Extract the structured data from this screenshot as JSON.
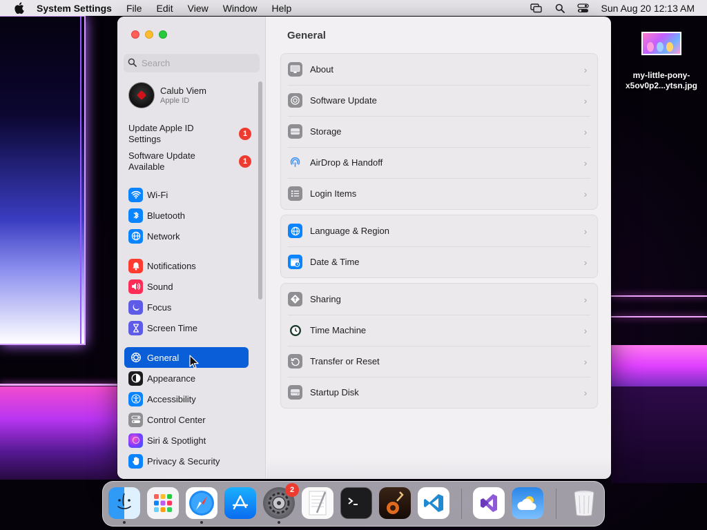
{
  "menubar": {
    "app_name": "System Settings",
    "menus": [
      "File",
      "Edit",
      "View",
      "Window",
      "Help"
    ],
    "status_icons": [
      "screen-mirroring-icon",
      "spotlight-search-icon",
      "control-center-icon"
    ],
    "clock": "Sun Aug 20  12:13 AM"
  },
  "desktop": {
    "file_name_line1": "my-little-pony-",
    "file_name_line2": "x5ov0p2...ytsn.jpg"
  },
  "sidebar": {
    "search_placeholder": "Search",
    "account": {
      "name": "Calub Viem",
      "subtitle": "Apple ID"
    },
    "notices": [
      {
        "label": "Update Apple ID Settings",
        "badge": "1"
      },
      {
        "label": "Software Update Available",
        "badge": "1"
      }
    ],
    "items": [
      {
        "label": "Wi-Fi",
        "icon": "wifi-icon",
        "color": "#0a84ff"
      },
      {
        "label": "Bluetooth",
        "icon": "bluetooth-icon",
        "color": "#0a84ff"
      },
      {
        "label": "Network",
        "icon": "globe-icon",
        "color": "#0a84ff"
      },
      {
        "label": "Notifications",
        "icon": "bell-icon",
        "color": "#ff3b30"
      },
      {
        "label": "Sound",
        "icon": "speaker-icon",
        "color": "#ff2d55"
      },
      {
        "label": "Focus",
        "icon": "moon-icon",
        "color": "#5e5ce6"
      },
      {
        "label": "Screen Time",
        "icon": "hourglass-icon",
        "color": "#5e5ce6"
      },
      {
        "label": "General",
        "icon": "gear-icon",
        "color": "#8e8e93",
        "active": true
      },
      {
        "label": "Appearance",
        "icon": "appearance-icon",
        "color": "#1c1c1e"
      },
      {
        "label": "Accessibility",
        "icon": "accessibility-icon",
        "color": "#0a84ff"
      },
      {
        "label": "Control Center",
        "icon": "control-center-icon",
        "color": "#8e8e93"
      },
      {
        "label": "Siri & Spotlight",
        "icon": "siri-icon",
        "color": "#7d3cff"
      },
      {
        "label": "Privacy & Security",
        "icon": "hand-icon",
        "color": "#0a84ff"
      }
    ]
  },
  "main": {
    "title": "General",
    "groups": [
      [
        {
          "label": "About",
          "icon": "mac-icon",
          "color": "#8e8e93"
        },
        {
          "label": "Software Update",
          "icon": "gear-badge-icon",
          "color": "#8e8e93"
        },
        {
          "label": "Storage",
          "icon": "drive-icon",
          "color": "#8e8e93"
        },
        {
          "label": "AirDrop & Handoff",
          "icon": "airdrop-icon",
          "color": "#ebe9ec"
        },
        {
          "label": "Login Items",
          "icon": "list-icon",
          "color": "#8e8e93"
        }
      ],
      [
        {
          "label": "Language & Region",
          "icon": "globe-icon",
          "color": "#0a84ff"
        },
        {
          "label": "Date & Time",
          "icon": "calendar-clock-icon",
          "color": "#0a84ff"
        }
      ],
      [
        {
          "label": "Sharing",
          "icon": "sharing-icon",
          "color": "#8e8e93"
        },
        {
          "label": "Time Machine",
          "icon": "time-machine-icon",
          "color": "#1c1c1e"
        },
        {
          "label": "Transfer or Reset",
          "icon": "reset-icon",
          "color": "#8e8e93"
        },
        {
          "label": "Startup Disk",
          "icon": "disk-icon",
          "color": "#8e8e93"
        }
      ]
    ]
  },
  "dock": {
    "apps": [
      {
        "name": "finder-icon",
        "running": true
      },
      {
        "name": "launchpad-icon",
        "running": false
      },
      {
        "name": "safari-icon",
        "running": true
      },
      {
        "name": "app-store-icon",
        "running": false
      },
      {
        "name": "system-settings-icon",
        "running": true,
        "badge": "2"
      },
      {
        "name": "textedit-icon",
        "running": false
      },
      {
        "name": "terminal-icon",
        "running": false
      },
      {
        "name": "garageband-icon",
        "running": false
      },
      {
        "name": "vscode-icon",
        "running": false
      },
      {
        "name": "visual-studio-icon",
        "running": false
      },
      {
        "name": "weather-icon",
        "running": false
      },
      {
        "name": "trash-icon",
        "running": false
      }
    ]
  }
}
